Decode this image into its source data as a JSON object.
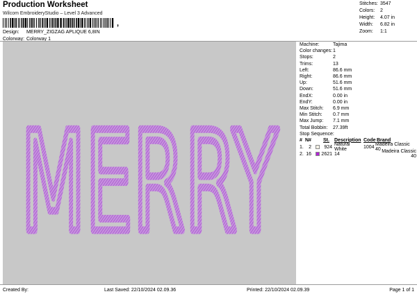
{
  "header": {
    "title": "Production Worksheet",
    "subtitle": "Wilcom EmbroideryStudio – Level 3 Advanced",
    "barcode_suffix": ","
  },
  "design": {
    "design_label": "Design:",
    "design_value": "MERRY_ZIGZAG APLIQUE 6,8IN",
    "colorway_label": "Colorway:",
    "colorway_value": "Colorway 1"
  },
  "stats": [
    {
      "label": "Stitches:",
      "value": "3547"
    },
    {
      "label": "Colors:",
      "value": "2"
    },
    {
      "label": "Height:",
      "value": "4.07 in"
    },
    {
      "label": "Width:",
      "value": "6.82 in"
    },
    {
      "label": "Zoom:",
      "value": "1:1"
    }
  ],
  "machine_info": [
    {
      "label": "Machine:",
      "value": "Tajima"
    },
    {
      "label": "Color changes:",
      "value": "1"
    },
    {
      "label": "Stops:",
      "value": "2"
    },
    {
      "label": "Trims:",
      "value": "13"
    },
    {
      "label": "Left:",
      "value": "86.6 mm"
    },
    {
      "label": "Right:",
      "value": "86.6 mm"
    },
    {
      "label": "Up:",
      "value": "51.6 mm"
    },
    {
      "label": "Down:",
      "value": "51.6 mm"
    },
    {
      "label": "EndX:",
      "value": "0.00 in"
    },
    {
      "label": "EndY:",
      "value": "0.00 in"
    },
    {
      "label": "Max Stitch:",
      "value": "6.9 mm"
    },
    {
      "label": "Min Stitch:",
      "value": "0.7 mm"
    },
    {
      "label": "Max Jump:",
      "value": "7.1 mm"
    },
    {
      "label": "Total Bobbin:",
      "value": "27.39ft"
    }
  ],
  "stop_sequence": {
    "title": "Stop Sequence:",
    "columns": [
      "#",
      "N#",
      "St.",
      "Description",
      "Code",
      "Brand"
    ],
    "rows": [
      {
        "index": "1.",
        "needle": "2",
        "color": "#f4f1e6",
        "code_num": "924",
        "description": "Natural White",
        "code": "1004",
        "brand": "Madeira Classic 40"
      },
      {
        "index": "2.",
        "needle": "16",
        "color": "#b026d4",
        "code_num": "2621",
        "description": "14",
        "code": "",
        "brand": "Madeira Classic 40"
      }
    ]
  },
  "artwork": {
    "text": "MERRY",
    "stitch_color": "#a94fd1",
    "fill_color": "#c8c8c8"
  },
  "footer": {
    "created_by": "Created By:",
    "last_saved": "Last Saved: 22/10/2024 02.09.36",
    "printed": "Printed: 22/10/2024 02.09.39",
    "page": "Page 1 of 1"
  }
}
